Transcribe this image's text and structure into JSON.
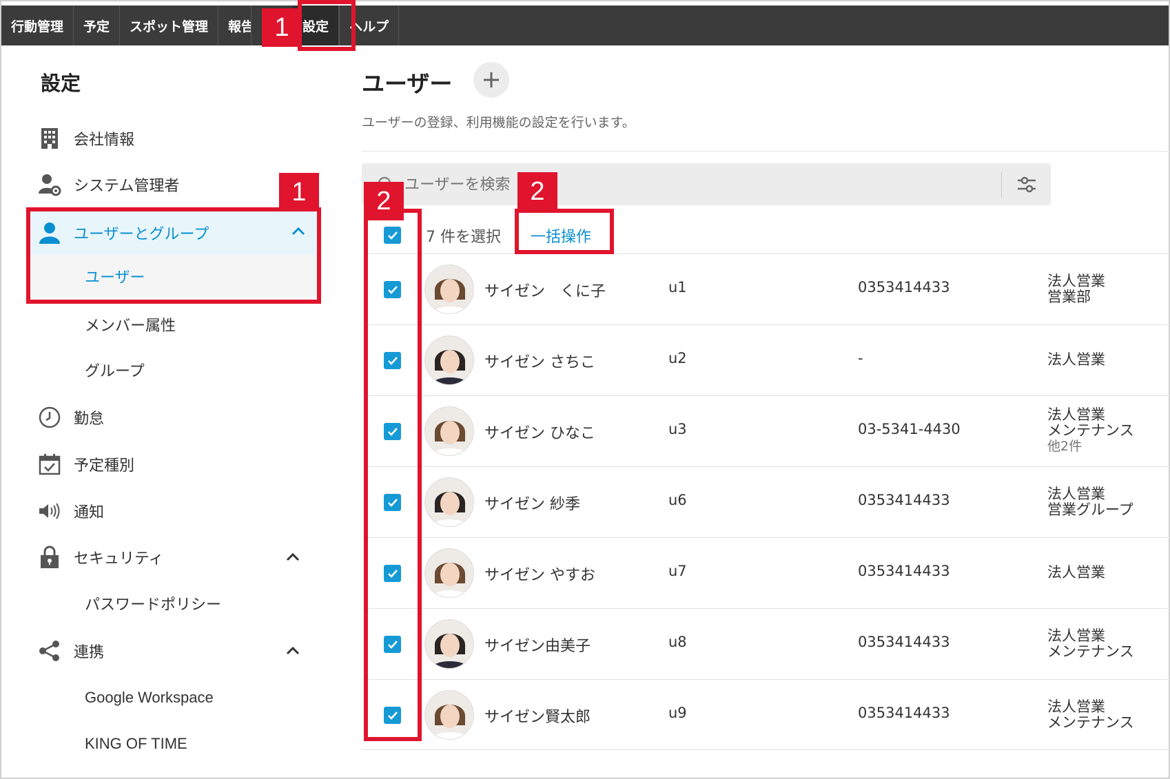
{
  "nav": {
    "items": [
      "行動管理",
      "予定",
      "スポット管理",
      "報告",
      "設定",
      "ヘルプ"
    ],
    "active": "設定"
  },
  "callouts": {
    "one": "1",
    "two": "2"
  },
  "sidebar": {
    "title": "設定",
    "items": {
      "company": "会社情報",
      "sysadmin": "システム管理者",
      "users_groups": "ユーザーとグループ",
      "users": "ユーザー",
      "member_attr": "メンバー属性",
      "groups": "グループ",
      "attendance": "勤怠",
      "schedule_type": "予定種別",
      "notification": "通知",
      "security": "セキュリティ",
      "password_policy": "パスワードポリシー",
      "integration": "連携",
      "google": "Google Workspace",
      "kingoftime": "KING OF TIME"
    }
  },
  "main": {
    "title": "ユーザー",
    "description": "ユーザーの登録、利用機能の設定を行います。",
    "search_placeholder": "ユーザーを検索",
    "selected_count": "7 件を選択",
    "bulk_action": "一括操作"
  },
  "users": [
    {
      "name": "サイゼン　くに子",
      "id": "u1",
      "phone": "0353414433",
      "groups": [
        "法人営業",
        "営業部"
      ],
      "more": ""
    },
    {
      "name": "サイゼン さちこ",
      "id": "u2",
      "phone": "-",
      "groups": [
        "法人営業"
      ],
      "more": ""
    },
    {
      "name": "サイゼン ひなこ",
      "id": "u3",
      "phone": "03-5341-4430",
      "groups": [
        "法人営業",
        "メンテナンス"
      ],
      "more": "他2件"
    },
    {
      "name": "サイゼン 紗季",
      "id": "u6",
      "phone": "0353414433",
      "groups": [
        "法人営業",
        "営業グループ"
      ],
      "more": ""
    },
    {
      "name": "サイゼン やすお",
      "id": "u7",
      "phone": "0353414433",
      "groups": [
        "法人営業"
      ],
      "more": ""
    },
    {
      "name": "サイゼン由美子",
      "id": "u8",
      "phone": "0353414433",
      "groups": [
        "法人営業",
        "メンテナンス"
      ],
      "more": ""
    },
    {
      "name": "サイゼン賢太郎",
      "id": "u9",
      "phone": "0353414433",
      "groups": [
        "法人営業",
        "メンテナンス"
      ],
      "more": ""
    }
  ],
  "colors": {
    "accent": "#0a8fd0",
    "checkbox": "#169ad6",
    "callout": "#e0142d",
    "topbar": "#3b3b3b"
  }
}
